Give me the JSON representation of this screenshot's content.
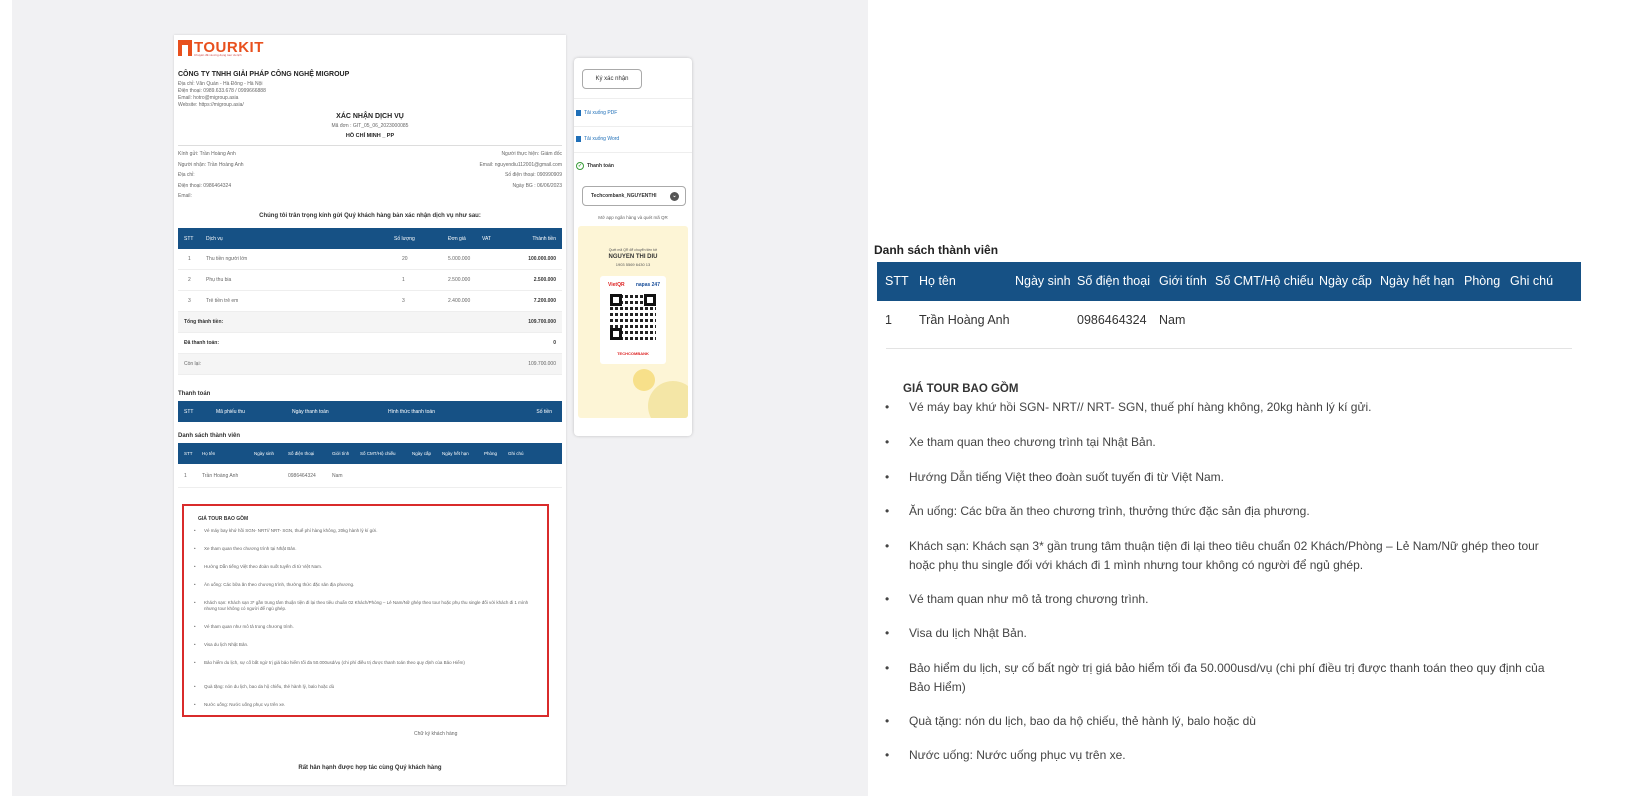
{
  "doc": {
    "logo": "TOURKIT",
    "logo_sub": "Chuyên đề và ứng dụng tour du lịch",
    "company": "CÔNG TY TNHH GIẢI PHÁP CÔNG NGHỆ MIGROUP",
    "address": "Địa chỉ: Văn Quán - Hà Đông - Hà Nội",
    "phone": "Điện thoại: 0989.633.678 / 0999666888",
    "email": "Email: hotro@migroup.asia",
    "website": "Website: https://migroup.asia/",
    "title": "XÁC NHẬN DỊCH VỤ",
    "order_code": "Mã đơn : GIT_05_06_2023000085",
    "city": "HỒ CHÍ MINH _ PP",
    "left_info": [
      "Kính gửi: Trần Hoàng Anh",
      "Người nhận: Trần Hoàng Anh",
      "Địa chỉ:",
      "Điện thoại: 0986464324",
      "Email:"
    ],
    "right_info": [
      "Người thực hiện: Giám đốc",
      "Email: nguyendiu112001@gmail.com",
      "Số điện thoại: 090990909",
      "Ngày BG : 06/06/2023"
    ],
    "intro": "Chúng tôi trân trọng kính gửi Quý khách hàng bản xác nhận dịch vụ như sau:",
    "svc_head": [
      "STT",
      "Dịch vụ",
      "Số lượng",
      "Đơn giá",
      "VAT",
      "Thành tiền"
    ],
    "svc_rows": [
      [
        "1",
        "Thu tiền người lớn",
        "20",
        "5.000.000",
        "",
        "100.000.000"
      ],
      [
        "2",
        "Phụ thu bia",
        "1",
        "2.500.000",
        "",
        "2.500.000"
      ],
      [
        "3",
        "Trẻ tiền trẻ em",
        "3",
        "2.400.000",
        "",
        "7.200.000"
      ]
    ],
    "sum_rows": [
      [
        "Tổng thành tiền:",
        "109.700.000"
      ],
      [
        "Đã thanh toán:",
        "0"
      ],
      [
        "Còn lại:",
        "109.700.000"
      ]
    ],
    "pay_label": "Thanh toán",
    "pay_head": [
      "STT",
      "Mã phiếu thu",
      "Ngày thanh toán",
      "Hình thức thanh toán",
      "Số tiền"
    ],
    "members_label": "Danh sách thành viên",
    "members_head": [
      "STT",
      "Họ tên",
      "Ngày sinh",
      "Số điện thoại",
      "Giới tính",
      "Số CMT/Hộ chiếu",
      "Ngày cấp",
      "Ngày hết hạn",
      "Phòng",
      "Ghi chú"
    ],
    "members_row": [
      "1",
      "Trần Hoàng Anh",
      "0986464324",
      "Nam"
    ],
    "sign_label": "Chữ ký khách hàng",
    "footer": "Rất hân hạnh được hợp tác cùng Quý khách hàng"
  },
  "side": {
    "sign_button": "Ký xác nhận",
    "download_pdf": "Tải xuống PDF",
    "download_word": "Tải xuống Word",
    "payment": "Thanh toán",
    "bank_select": "Techcombank_NGUYENTHI",
    "qr_hint": "Mở app ngân hàng và quét mã QR",
    "qr_sub": "Quét mã QR để chuyển tiền tới",
    "qr_name": "NGUYEN THI DIU",
    "qr_account": "1903 5569 6430 13",
    "vietqr": "VietQR",
    "napas": "napas 247",
    "bank_logo": "TECHCOMBANK"
  },
  "zoom": {
    "title": "Danh sách thành viên",
    "head": [
      "STT",
      "Họ tên",
      "Ngày sinh",
      "Số điện thoại",
      "Giới tính",
      "Số CMT/Hộ chiếu",
      "Ngày cấp",
      "Ngày hết hạn",
      "Phòng",
      "Ghi chú"
    ],
    "row": [
      "1",
      "Trần Hoàng Anh",
      "0986464324",
      "Nam"
    ],
    "section": "GIÁ TOUR BAO GỒM",
    "items": [
      "Vé máy bay khứ hồi SGN- NRT// NRT- SGN, thuế phí hàng không, 20kg hành lý kí gửi.",
      "Xe tham quan theo chương trình tại Nhật Bản.",
      "Hướng Dẫn tiếng Việt theo đoàn suốt tuyến đi từ Việt Nam.",
      "Ăn uống: Các bữa ăn theo chương trình, thưởng thức đặc sản địa phương.",
      "Khách sạn: Khách sạn 3* gần trung tâm thuận tiện đi lại theo tiêu chuẩn 02 Khách/Phòng – Lẻ Nam/Nữ ghép theo tour hoặc phụ thu single đối với khách đi 1 mình nhưng tour không có người để ngủ ghép.",
      "Vé tham quan như mô tả trong chương trình.",
      "Visa du lịch Nhật Bản.",
      "Bảo hiểm du lịch, sự cố bất ngờ trị giá bảo hiểm tối đa 50.000usd/vụ (chi phí điều trị được thanh toán theo quy định của Bảo Hiểm)",
      "Quà tặng: nón du lịch, bao da hộ chiếu, thẻ hành lý, balo hoặc dù",
      "Nước uống: Nước uống phục vụ trên xe."
    ]
  }
}
